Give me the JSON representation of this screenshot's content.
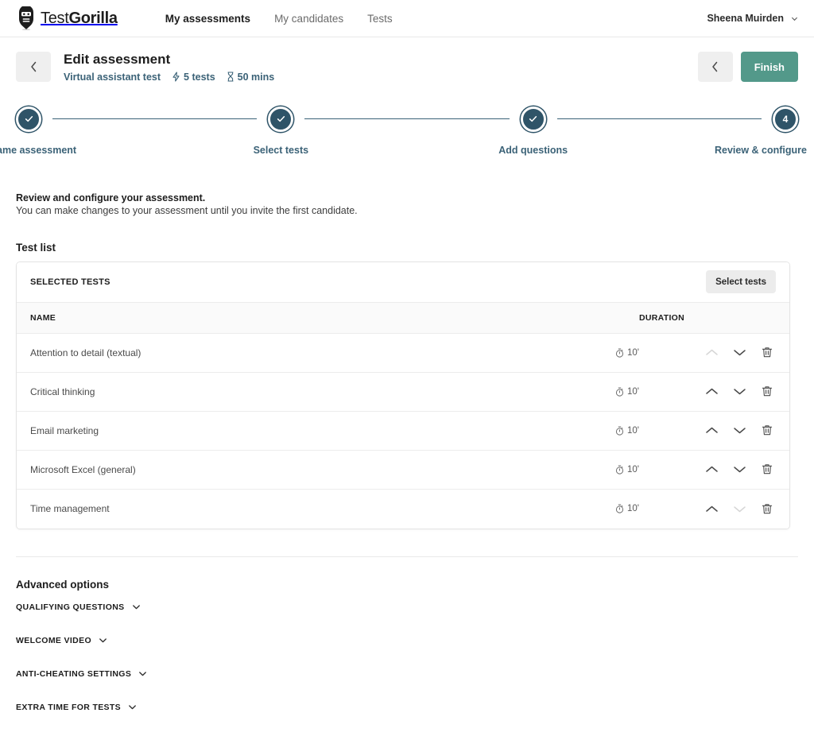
{
  "nav": {
    "brand": {
      "light": "Test",
      "bold": "Gorilla",
      "icon": "gorilla-logo-icon"
    },
    "links": [
      {
        "label": "My assessments",
        "active": true
      },
      {
        "label": "My candidates",
        "active": false
      },
      {
        "label": "Tests",
        "active": false
      }
    ],
    "user": {
      "name": "Sheena Muirden",
      "caret_icon": "chevron-down-icon"
    }
  },
  "header": {
    "back_icon": "chevron-left-icon",
    "title": "Edit assessment",
    "assessment_name": "Virtual assistant test",
    "tests_count": "5 tests",
    "tests_icon": "lightning-bolt-icon",
    "duration": "50 mins",
    "duration_icon": "hourglass-icon",
    "prev_icon": "chevron-left-icon",
    "finish_label": "Finish"
  },
  "stepper": {
    "steps": [
      {
        "label": "Name assessment",
        "state": "complete",
        "marker": "check-icon"
      },
      {
        "label": "Select tests",
        "state": "complete",
        "marker": "check-icon"
      },
      {
        "label": "Add questions",
        "state": "complete",
        "marker": "check-icon"
      },
      {
        "label": "Review & configure",
        "state": "current",
        "marker": "4"
      }
    ]
  },
  "intro": {
    "title": "Review and configure your assessment.",
    "subtitle": "You can make changes to your assessment until you invite the first candidate."
  },
  "test_list": {
    "section_title": "Test list",
    "card_title": "SELECTED TESTS",
    "select_tests_label": "Select tests",
    "columns": {
      "name": "NAME",
      "duration": "DURATION"
    },
    "rows": [
      {
        "name": "Attention to detail (textual)",
        "duration": "10'",
        "timer_icon": "stopwatch-icon",
        "move_up_enabled": false,
        "move_down_enabled": true
      },
      {
        "name": "Critical thinking",
        "duration": "10'",
        "timer_icon": "stopwatch-icon",
        "move_up_enabled": true,
        "move_down_enabled": true
      },
      {
        "name": "Email marketing",
        "duration": "10'",
        "timer_icon": "stopwatch-icon",
        "move_up_enabled": true,
        "move_down_enabled": true
      },
      {
        "name": "Microsoft Excel (general)",
        "duration": "10'",
        "timer_icon": "stopwatch-icon",
        "move_up_enabled": true,
        "move_down_enabled": true
      },
      {
        "name": "Time management",
        "duration": "10'",
        "timer_icon": "stopwatch-icon",
        "move_up_enabled": true,
        "move_down_enabled": false
      }
    ]
  },
  "advanced": {
    "title": "Advanced options",
    "items": [
      {
        "label": "QUALIFYING QUESTIONS",
        "chevron_icon": "chevron-down-icon"
      },
      {
        "label": "WELCOME VIDEO",
        "chevron_icon": "chevron-down-icon"
      },
      {
        "label": "ANTI-CHEATING SETTINGS",
        "chevron_icon": "chevron-down-icon"
      },
      {
        "label": "EXTRA TIME FOR TESTS",
        "chevron_icon": "chevron-down-icon"
      }
    ]
  },
  "colors": {
    "accent_teal": "#53998a",
    "step_navy": "#2f5468",
    "link_blue": "#3b6277",
    "border_gray": "#e8e8e8",
    "page_bg": "#ffffff"
  }
}
